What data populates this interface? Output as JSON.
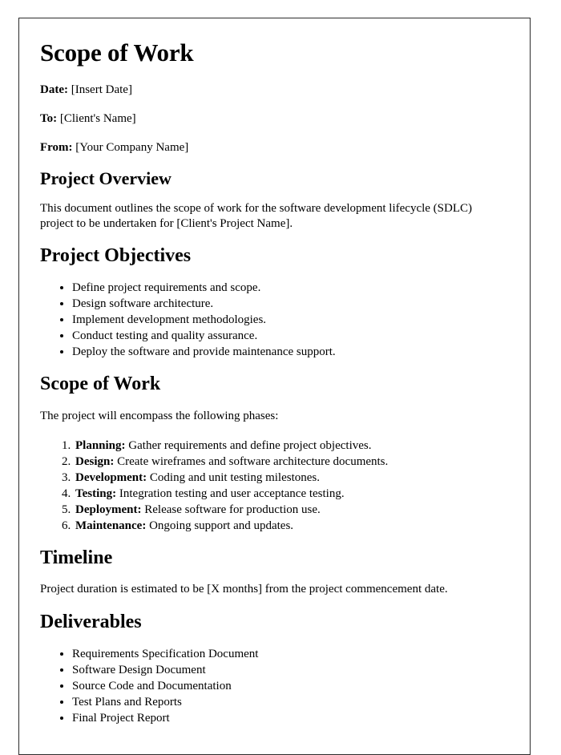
{
  "document": {
    "title": "Scope of Work",
    "meta": [
      {
        "label": "Date:",
        "value": "[Insert Date]"
      },
      {
        "label": "To:",
        "value": "[Client's Name]"
      },
      {
        "label": "From:",
        "value": "[Your Company Name]"
      }
    ],
    "sections": {
      "overview": {
        "heading": "Project Overview",
        "paragraph": "This document outlines the scope of work for the software development lifecycle (SDLC) project to be undertaken for [Client's Project Name]."
      },
      "objectives": {
        "heading": "Project Objectives",
        "items": [
          "Define project requirements and scope.",
          "Design software architecture.",
          "Implement development methodologies.",
          "Conduct testing and quality assurance.",
          "Deploy the software and provide maintenance support."
        ]
      },
      "scope": {
        "heading": "Scope of Work",
        "paragraph": "The project will encompass the following phases:",
        "phases": [
          {
            "label": "Planning:",
            "text": "Gather requirements and define project objectives."
          },
          {
            "label": "Design:",
            "text": "Create wireframes and software architecture documents."
          },
          {
            "label": "Development:",
            "text": "Coding and unit testing milestones."
          },
          {
            "label": "Testing:",
            "text": "Integration testing and user acceptance testing."
          },
          {
            "label": "Deployment:",
            "text": "Release software for production use."
          },
          {
            "label": "Maintenance:",
            "text": "Ongoing support and updates."
          }
        ]
      },
      "timeline": {
        "heading": "Timeline",
        "paragraph": "Project duration is estimated to be [X months] from the project commencement date."
      },
      "deliverables": {
        "heading": "Deliverables",
        "items": [
          "Requirements Specification Document",
          "Software Design Document",
          "Source Code and Documentation",
          "Test Plans and Reports",
          "Final Project Report"
        ]
      }
    }
  },
  "style": {
    "page_border_color": "#2b2b2b",
    "text_color": "#000000",
    "background_color": "#ffffff"
  }
}
